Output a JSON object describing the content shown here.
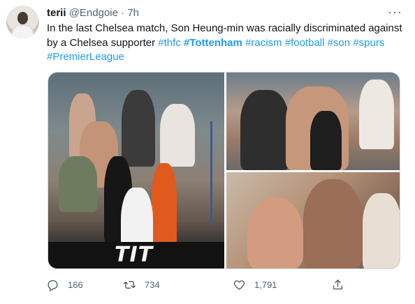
{
  "author": {
    "name": "terii",
    "handle": "@Endgoie",
    "separator": "·",
    "time": "7h"
  },
  "more_label": "···",
  "tweet": {
    "text_plain": "In the last Chelsea match, Son Heung-min was racially discriminated against by a Chelsea supporter ",
    "hashtags": [
      "#thfc",
      "#Tottenham",
      "#racism",
      "#football",
      "#son",
      "#spurs",
      "#PremierLeague"
    ]
  },
  "media": {
    "board_text": "TIT"
  },
  "actions": {
    "reply_count": "166",
    "retweet_count": "734",
    "like_count": "1,791",
    "reply_icon": "reply-icon",
    "retweet_icon": "retweet-icon",
    "like_icon": "heart-icon",
    "share_icon": "share-icon"
  },
  "colors": {
    "accent": "#1d9bf0",
    "text": "#0f1419",
    "secondary": "#536471"
  }
}
